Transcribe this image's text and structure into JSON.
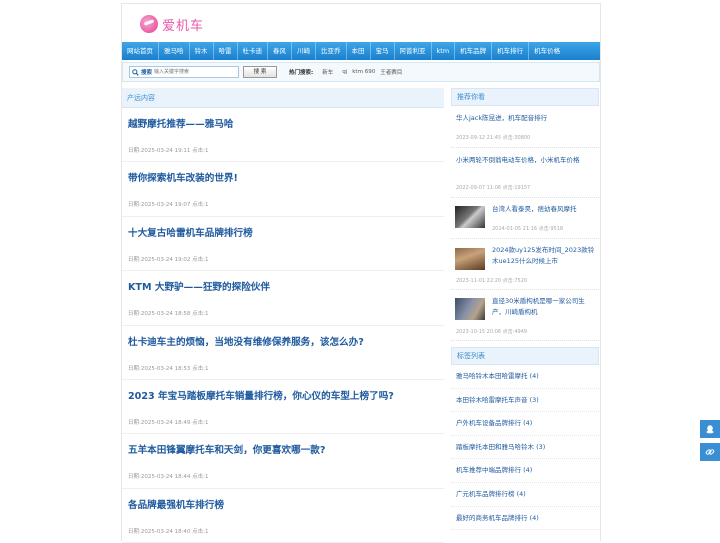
{
  "site": {
    "logo_text": "爱机车"
  },
  "nav": {
    "items": [
      "网站首页",
      "雅马哈",
      "铃木",
      "哈雷",
      "杜卡迪",
      "春风",
      "川崎",
      "比亚乔",
      "本田",
      "宝马",
      "阿普利亚",
      "ktm",
      "机车品牌",
      "机车排行",
      "机车价格"
    ]
  },
  "search": {
    "label": "搜索",
    "placeholder": "输入关键字搜索",
    "button": "搜 索",
    "hot_label": "热门搜索:",
    "hot_links": [
      "新车",
      "qj",
      "ktm 690",
      "王者赛目"
    ]
  },
  "main": {
    "heading": "产远内容",
    "articles": [
      {
        "title": "越野摩托推荐——雅马哈",
        "meta": "日期:2025-03-24 19:11  点击:1"
      },
      {
        "title": "带你探索机车改装的世界!",
        "meta": "日期:2025-03-24 19:07  点击:1"
      },
      {
        "title": "十大复古哈雷机车品牌排行榜",
        "meta": "日期:2025-03-24 19:02  点击:1"
      },
      {
        "title": "KTM 大野驴——狂野的探险伙伴",
        "meta": "日期:2025-03-24 18:58  点击:1"
      },
      {
        "title": "杜卡迪车主的烦恼，当地没有维修保养服务，该怎么办?",
        "meta": "日期:2025-03-24 18:53  点击:1"
      },
      {
        "title": "2023 年宝马踏板摩托车销量排行榜，你心仪的车型上榜了吗?",
        "meta": "日期:2025-03-24 18:49  点击:1"
      },
      {
        "title": "五羊本田锋翼摩托车和天剑，你更喜欢哪一款?",
        "meta": "日期:2025-03-24 18:44  点击:1"
      },
      {
        "title": "各品牌最强机车排行榜",
        "meta": "日期:2025-03-24 18:40  点击:1"
      }
    ]
  },
  "sidebar": {
    "recommend_heading": "推荐你看",
    "recommend": [
      {
        "title": "华人jack陈昆进，机车配音排行",
        "meta": "2023-09-12 21:45  点击:30800",
        "thumb": false
      },
      {
        "title": "小米两轮不倒翁电动车价格，小米机车价格",
        "meta": "2022-09-07 11:06  点击:19157",
        "thumb": false
      },
      {
        "title": "台湾人看泰昊，痞幼春风摩托",
        "meta": "2024-01-05 21:16  点击:9518",
        "thumb": true
      },
      {
        "title": "2024款uy125发布时间_2023款铃木ue125什么时候上市",
        "meta": "2023-11-01 22:20  点击:7520",
        "thumb": true
      },
      {
        "title": "直径30米盾构机是哪一家公司生产，川崎盾构机",
        "meta": "2023-10-15 20:06  点击:4949",
        "thumb": true
      }
    ],
    "tags_heading": "标签列表",
    "tags": [
      "雅马哈铃木本田哈雷摩托 (4)",
      "本田铃木哈雷摩托车声音 (3)",
      "户外机车设备品牌排行 (4)",
      "踏板摩托本田和雅马哈铃木 (3)",
      "机车推荐中端品牌排行 (4)",
      "广元机车品牌排行榜 (4)",
      "最好的商务机车品牌排行 (4)"
    ]
  }
}
